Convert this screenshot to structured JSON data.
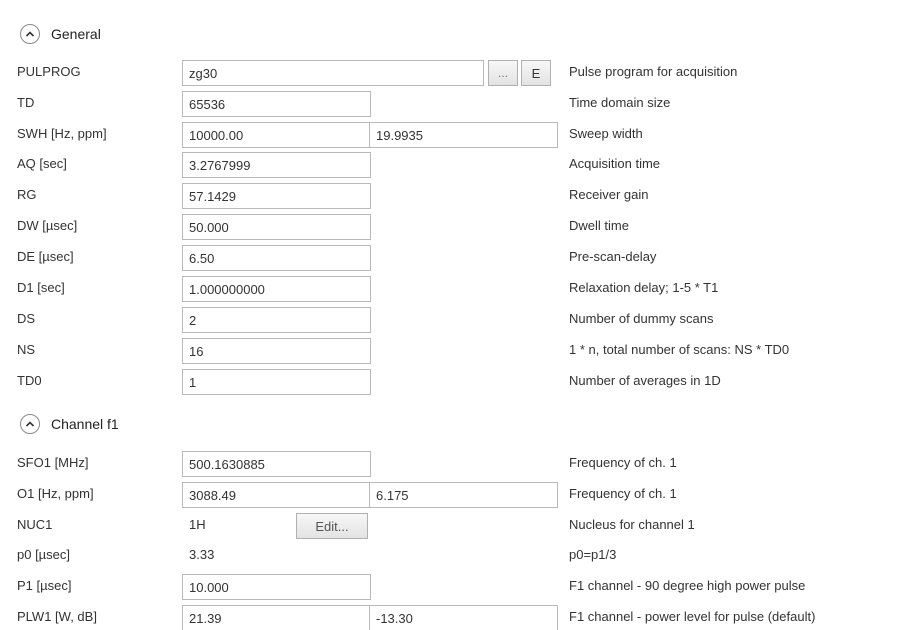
{
  "sections": {
    "general": {
      "title": "General"
    },
    "channel": {
      "title": "Channel f1"
    }
  },
  "rows": {
    "pulprog": {
      "label": "PULPROG",
      "value": "zg30",
      "browse_label": "...",
      "edit_label": "E",
      "desc": "Pulse program for acquisition"
    },
    "td": {
      "label": "TD",
      "value": "65536",
      "desc": "Time domain size"
    },
    "swh": {
      "label": "SWH [Hz, ppm]",
      "value": "10000.00",
      "value2": "19.9935",
      "desc": "Sweep width"
    },
    "aq": {
      "label": "AQ [sec]",
      "value": "3.2767999",
      "desc": "Acquisition time"
    },
    "rg": {
      "label": "RG",
      "value": "57.1429",
      "desc": "Receiver gain"
    },
    "dw": {
      "label": "DW [µsec]",
      "value": "50.000",
      "desc": "Dwell time"
    },
    "de": {
      "label": "DE [µsec]",
      "value": "6.50",
      "desc": "Pre-scan-delay"
    },
    "d1": {
      "label": "D1 [sec]",
      "value": "1.000000000",
      "desc": "Relaxation delay; 1-5 * T1"
    },
    "ds": {
      "label": "DS",
      "value": "2",
      "desc": "Number of dummy scans"
    },
    "ns": {
      "label": "NS",
      "value": "16",
      "desc": "1 * n, total number of scans: NS * TD0"
    },
    "td0": {
      "label": "TD0",
      "value": "1",
      "desc": "Number of averages in 1D"
    },
    "sfo1": {
      "label": "SFO1 [MHz]",
      "value": "500.1630885",
      "desc": "Frequency of ch. 1"
    },
    "o1": {
      "label": "O1 [Hz, ppm]",
      "value": "3088.49",
      "value2": "6.175",
      "desc": "Frequency of ch. 1"
    },
    "nuc1": {
      "label": "NUC1",
      "value": "1H",
      "edit_label": "Edit...",
      "desc": "Nucleus for channel 1"
    },
    "p0": {
      "label": "p0 [µsec]",
      "value": "3.33",
      "desc": "p0=p1/3"
    },
    "p1": {
      "label": "P1 [µsec]",
      "value": "10.000",
      "desc": "F1 channel -  90 degree high power pulse"
    },
    "plw1": {
      "label": "PLW1 [W, dB]",
      "value": "21.39",
      "value2": "-13.30",
      "desc": "F1 channel - power level for pulse (default)"
    }
  },
  "icons": {
    "collapse": "chevron-up-icon"
  }
}
